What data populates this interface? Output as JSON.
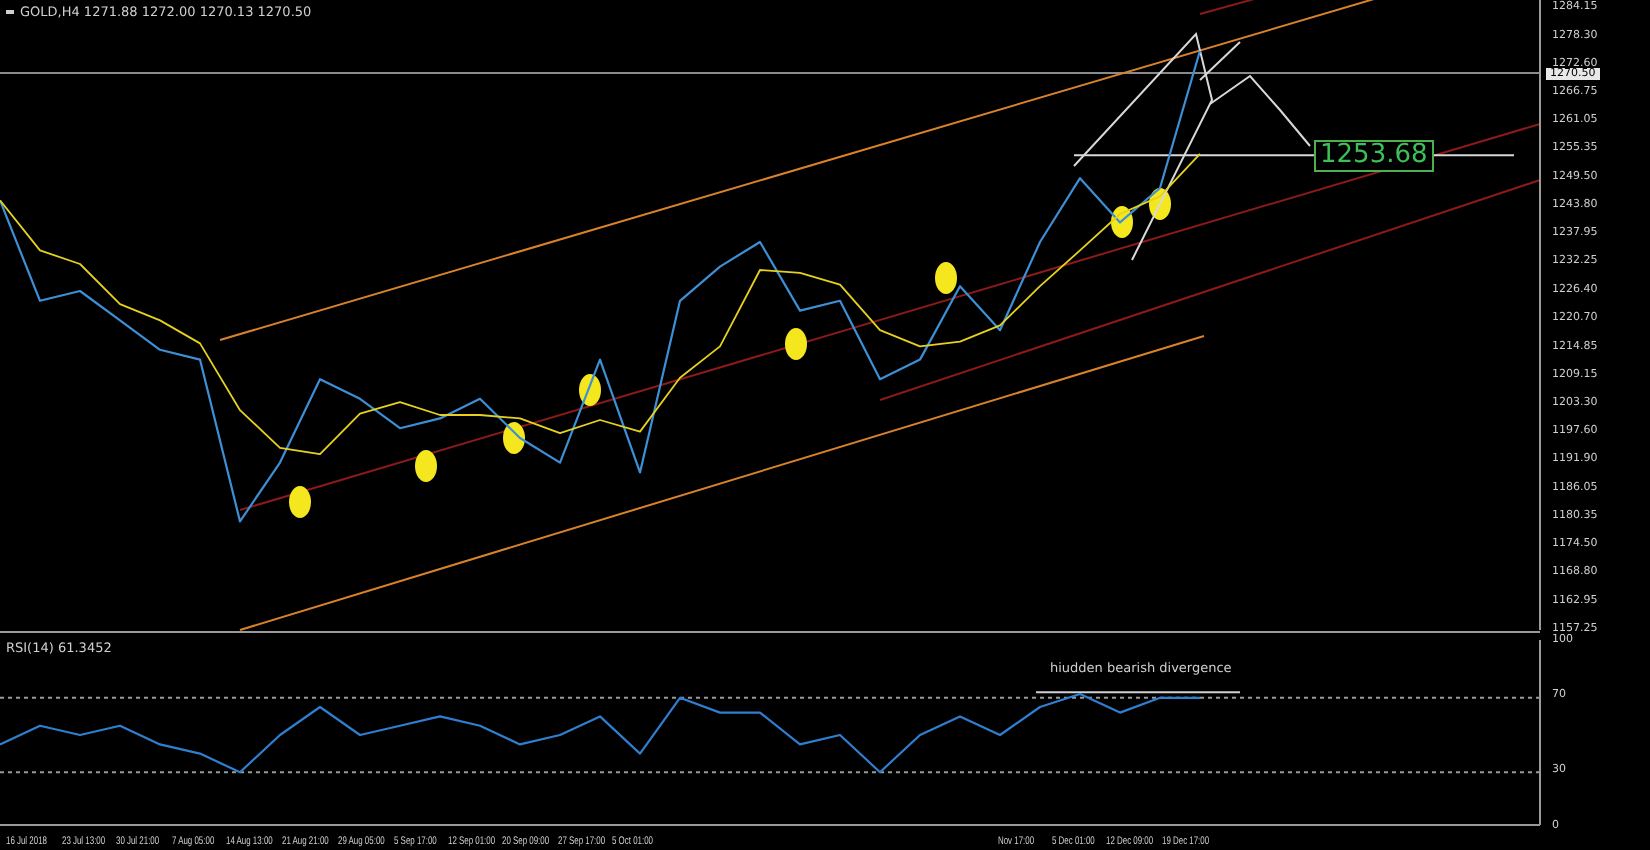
{
  "chart": {
    "quote": "1271.88 1272.00 1270.13 1270.50",
    "current_price": "1270.50",
    "target_label": "1253.68",
    "chart_data": {
      "type": "line",
      "ylim": [
        1157.25,
        1284.15
      ],
      "yticks": [
        {
          "value": 1284.15,
          "label": "1284.15"
        },
        {
          "value": 1278.3,
          "label": "1278.30"
        },
        {
          "value": 1272.6,
          "label": "1272.60"
        },
        {
          "value": 1266.75,
          "label": "1266.75"
        },
        {
          "value": 1261.05,
          "label": "1261.05"
        },
        {
          "value": 1255.35,
          "label": "1255.35"
        },
        {
          "value": 1249.5,
          "label": "1249.50"
        },
        {
          "value": 1243.8,
          "label": "1243.80"
        },
        {
          "value": 1237.95,
          "label": "1237.95"
        },
        {
          "value": 1232.25,
          "label": "1232.25"
        },
        {
          "value": 1226.4,
          "label": "1226.40"
        },
        {
          "value": 1220.7,
          "label": "1220.70"
        },
        {
          "value": 1214.85,
          "label": "1214.85"
        },
        {
          "value": 1209.15,
          "label": "1209.15"
        },
        {
          "value": 1203.3,
          "label": "1203.30"
        },
        {
          "value": 1197.6,
          "label": "1197.60"
        },
        {
          "value": 1191.9,
          "label": "1191.90"
        },
        {
          "value": 1186.05,
          "label": "1186.05"
        },
        {
          "value": 1180.35,
          "label": "1180.35"
        },
        {
          "value": 1174.5,
          "label": "1174.50"
        },
        {
          "value": 1168.8,
          "label": "1168.80"
        },
        {
          "value": 1162.95,
          "label": "1162.95"
        },
        {
          "value": 1157.25,
          "label": "1157.25"
        }
      ],
      "series": [
        {
          "name": "GOLD,H4",
          "color": "#3d8fd6",
          "values": [
            1244.5,
            1224,
            1226,
            1220,
            1214,
            1212,
            1179,
            1191,
            1208,
            1204,
            1198,
            1200,
            1204,
            1196,
            1191,
            1212,
            1189,
            1224,
            1231,
            1236,
            1222,
            1224,
            1208,
            1212,
            1227,
            1218,
            1236,
            1249,
            1240,
            1247,
            1275
          ]
        },
        {
          "color": "#e6d21e",
          "values": [
            1244.5,
            1234.3,
            1231.5,
            1223.3,
            1220,
            1215.3,
            1201.7,
            1194,
            1192.7,
            1201,
            1203.3,
            1200.7,
            1200.7,
            1200,
            1197,
            1199.7,
            1197.3,
            1208.3,
            1214.7,
            1230.3,
            1229.7,
            1227.3,
            1218,
            1214.7,
            1215.7,
            1219,
            1227,
            1234.3,
            1241.7,
            1245.3,
            1254
          ]
        }
      ]
    }
  },
  "rsi": {
    "reading": "61.3452",
    "annotation": "hiudden bearish divergence",
    "chart_data": {
      "type": "line",
      "ylim": [
        0,
        100
      ],
      "yticks": [
        {
          "value": 100,
          "label": "100"
        },
        {
          "value": 70,
          "label": "70"
        },
        {
          "value": 30,
          "label": "30"
        },
        {
          "value": 0,
          "label": "0"
        }
      ],
      "series": [
        {
          "name": "RSI(14)",
          "color": "#2f7fd0",
          "values": [
            45,
            55,
            50,
            55,
            45,
            40,
            30,
            50,
            65,
            50,
            55,
            60,
            55,
            45,
            50,
            60,
            40,
            70,
            62,
            62,
            45,
            50,
            30,
            50,
            60,
            50,
            65,
            72,
            62,
            70,
            70
          ]
        }
      ]
    }
  },
  "time_axis": [
    "16 Jul 2018",
    "23 Jul 13:00",
    "30 Jul 21:00",
    "7 Aug 05:00",
    "14 Aug 13:00",
    "21 Aug 21:00",
    "29 Aug 05:00",
    "5 Sep 17:00",
    "12 Sep 01:00",
    "20 Sep 09:00",
    "27 Sep 17:00",
    "5 Oct 01:00",
    "Nov 17:00",
    "5 Dec 01:00",
    "12 Dec 09:00",
    "19 Dec 17:00"
  ]
}
